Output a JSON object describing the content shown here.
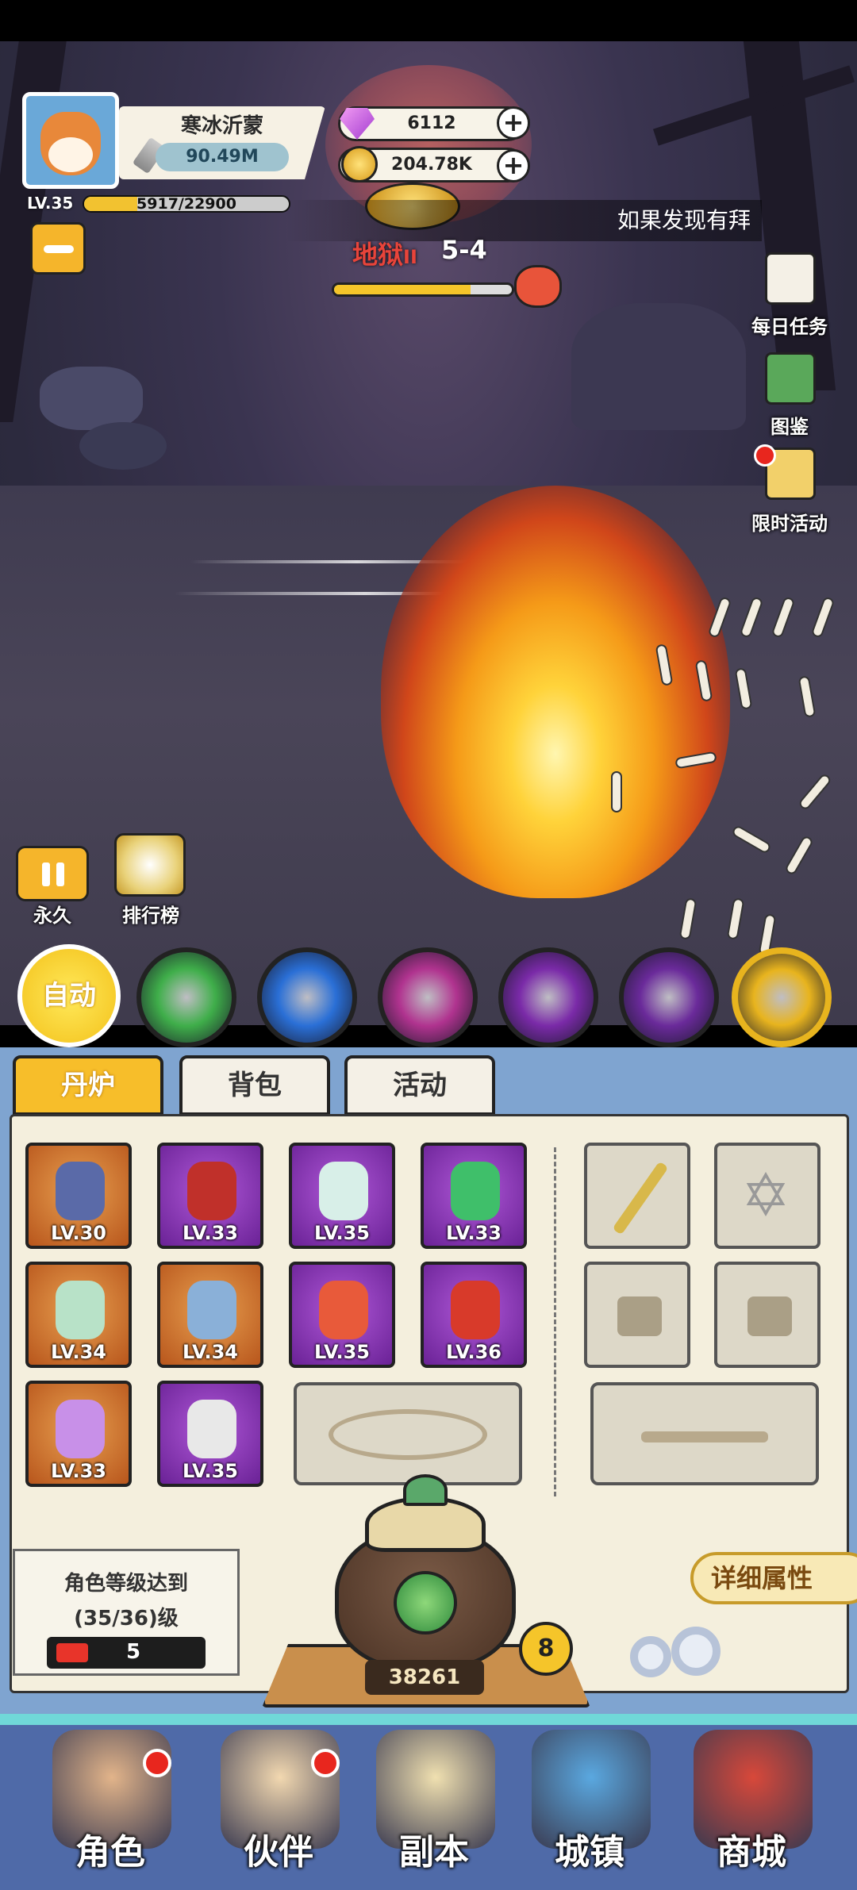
{
  "player": {
    "name": "寒冰沂蒙",
    "power": "90.49M",
    "level": "LV.35",
    "exp_text": "5917/22900",
    "exp_progress": 0.26
  },
  "currency": {
    "gems": "6112",
    "gold": "204.78K"
  },
  "notice": {
    "text": "如果发现有拜"
  },
  "stage": {
    "name": "地狱",
    "numeral": "II",
    "level": "5-4",
    "progress": 0.77
  },
  "side_menu": [
    {
      "label": "每日任务",
      "icon": "scroll-icon"
    },
    {
      "label": "图鉴",
      "icon": "book-icon"
    },
    {
      "label": "限时活动",
      "icon": "party-icon",
      "badge": true
    }
  ],
  "battle_controls": {
    "auto_label": "永久",
    "rank_label": "排行榜",
    "auto_button": "自动"
  },
  "skills": [
    {
      "name": "green-vortex-skill",
      "color": "#3fae4a"
    },
    {
      "name": "blue-comet-skill",
      "color": "#2a6fd6"
    },
    {
      "name": "purple-swirl-skill",
      "color": "#b0338f"
    },
    {
      "name": "purple-lightning-skill",
      "color": "#7a2aa8"
    },
    {
      "name": "violet-ring-skill",
      "color": "#6a2a9a"
    },
    {
      "name": "gold-ultimate-skill",
      "color": "#e8b41e"
    }
  ],
  "tabs": [
    {
      "label": "丹炉",
      "active": true
    },
    {
      "label": "背包",
      "active": false
    },
    {
      "label": "活动",
      "active": false
    }
  ],
  "equipment": [
    {
      "name": "spear",
      "level": "LV.30",
      "rarity": "orange",
      "color": "#5a6aa8"
    },
    {
      "name": "belt",
      "level": "LV.33",
      "rarity": "purple",
      "color": "#c0302a"
    },
    {
      "name": "robe",
      "level": "LV.35",
      "rarity": "purple",
      "color": "#d8efe8"
    },
    {
      "name": "orb",
      "level": "LV.33",
      "rarity": "purple",
      "color": "#3fbf6a"
    },
    {
      "name": "fan",
      "level": "LV.34",
      "rarity": "orange",
      "color": "#b8e2c8"
    },
    {
      "name": "shield",
      "level": "LV.34",
      "rarity": "orange",
      "color": "#8ab0d8"
    },
    {
      "name": "gourd",
      "level": "LV.35",
      "rarity": "purple",
      "color": "#e85a3a"
    },
    {
      "name": "pearl",
      "level": "LV.36",
      "rarity": "purple",
      "color": "#d83a2a"
    },
    {
      "name": "necklace",
      "level": "LV.33",
      "rarity": "orange",
      "color": "#c890e8"
    },
    {
      "name": "boots",
      "level": "LV.35",
      "rarity": "purple",
      "color": "#e8e8e8"
    }
  ],
  "furnace": {
    "requirement_line1": "角色等级达到",
    "requirement_line2": "(35/36)级",
    "ticket_count": "5",
    "count": "38261",
    "level": "8",
    "attr_button": "详细属性"
  },
  "bottom_nav": [
    {
      "label": "角色",
      "badge": true,
      "color": "#e2b48a"
    },
    {
      "label": "伙伴",
      "badge": true,
      "color": "#f2d8b0"
    },
    {
      "label": "副本",
      "badge": false,
      "color": "#f0e0b0"
    },
    {
      "label": "城镇",
      "badge": false,
      "color": "#5aa8e0"
    },
    {
      "label": "商城",
      "badge": false,
      "color": "#d8483a"
    }
  ]
}
